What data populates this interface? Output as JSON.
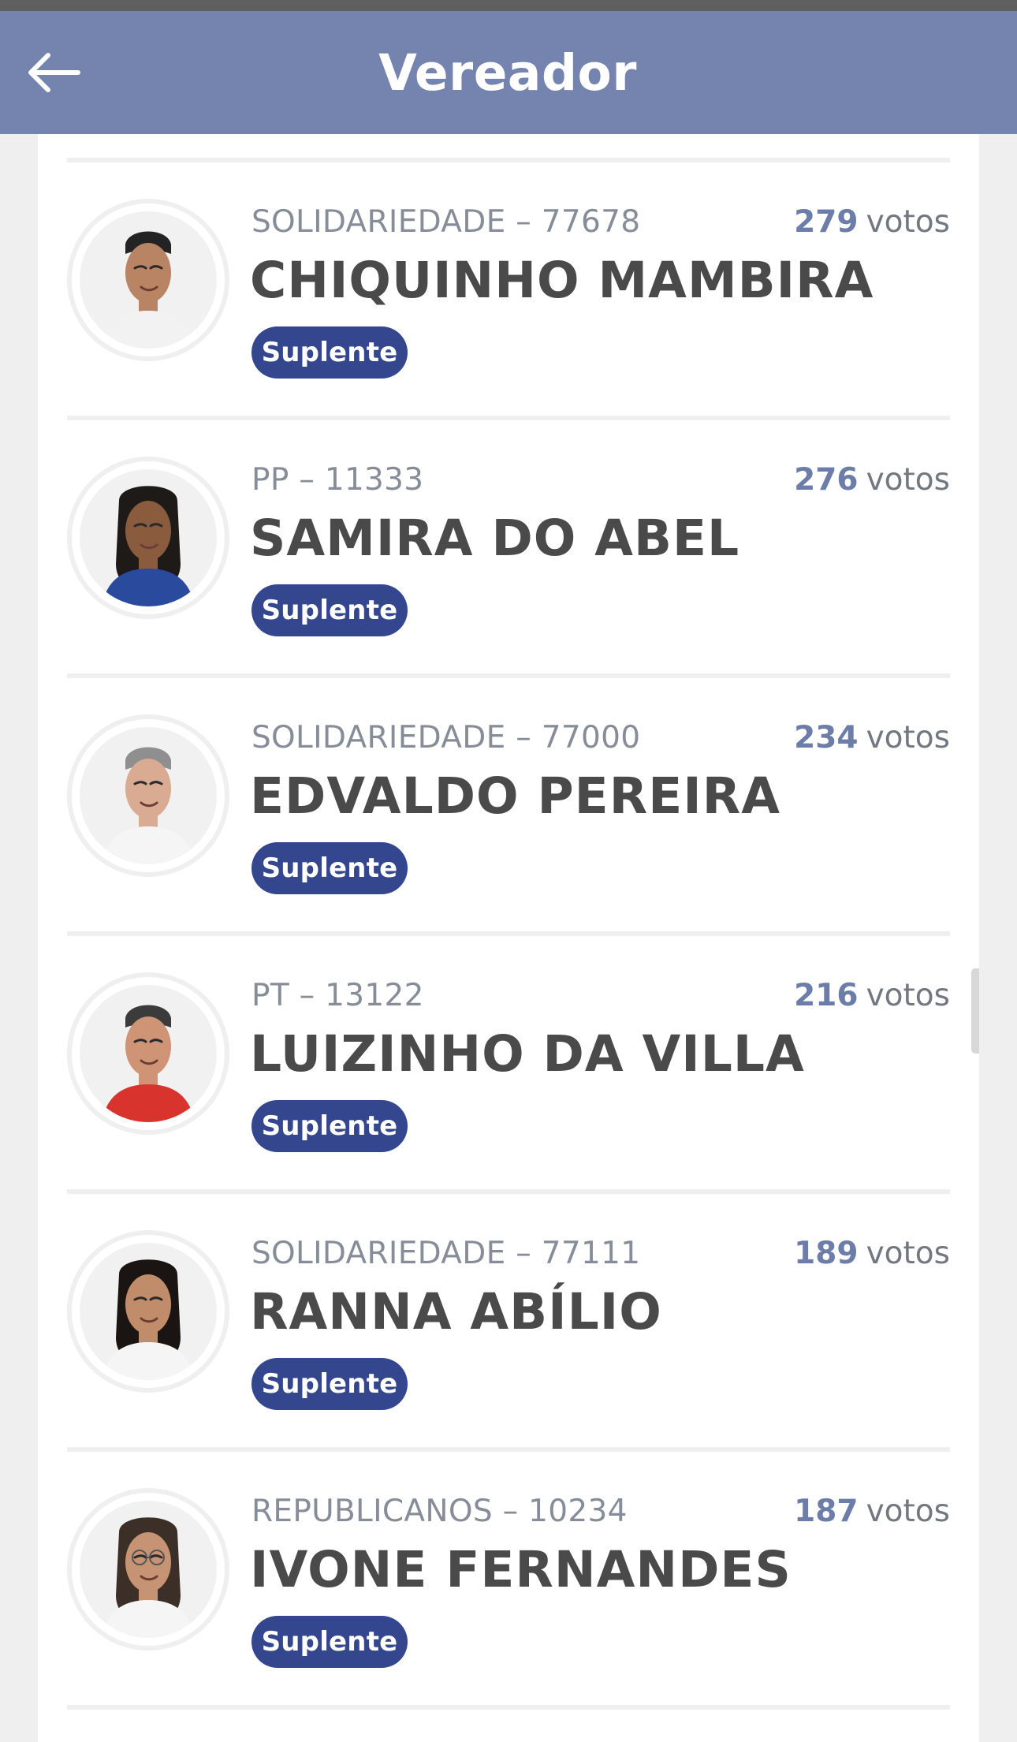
{
  "header": {
    "title": "Vereador",
    "back_icon": "arrow-left-icon"
  },
  "candidates": [
    {
      "party": "SOLIDARIEDADE – 77678",
      "name": "CHIQUINHO MAMBIRA",
      "votes": "279",
      "votes_label": "votos",
      "status": "Suplente",
      "skin": "#b88463",
      "hair": "#232323",
      "shirt": "#f2f2f2"
    },
    {
      "party": "PP – 11333",
      "name": "SAMIRA DO ABEL",
      "votes": "276",
      "votes_label": "votos",
      "status": "Suplente",
      "skin": "#8b5b3e",
      "hair": "#1e1a18",
      "shirt": "#2a4a9d"
    },
    {
      "party": "SOLIDARIEDADE – 77000",
      "name": "EDVALDO PEREIRA",
      "votes": "234",
      "votes_label": "votos",
      "status": "Suplente",
      "skin": "#d9ab92",
      "hair": "#8f8f8f",
      "shirt": "#f5f5f5"
    },
    {
      "party": "PT – 13122",
      "name": "LUIZINHO DA VILLA",
      "votes": "216",
      "votes_label": "votos",
      "status": "Suplente",
      "skin": "#cf9376",
      "hair": "#3b3b3b",
      "shirt": "#d9332d"
    },
    {
      "party": "SOLIDARIEDADE – 77111",
      "name": "RANNA ABÍLIO",
      "votes": "189",
      "votes_label": "votos",
      "status": "Suplente",
      "skin": "#c18c69",
      "hair": "#1a1512",
      "shirt": "#f5f5f5"
    },
    {
      "party": "REPUBLICANOS – 10234",
      "name": "IVONE FERNANDES",
      "votes": "187",
      "votes_label": "votos",
      "status": "Suplente",
      "skin": "#c69474",
      "hair": "#3b2f28",
      "shirt": "#f5f5f5"
    }
  ]
}
